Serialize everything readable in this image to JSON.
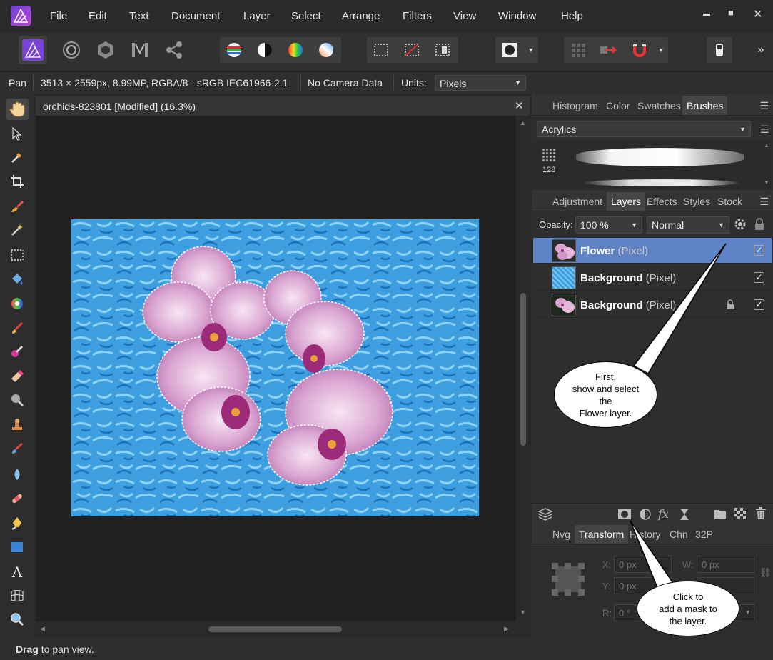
{
  "menu": {
    "items": [
      "File",
      "Edit",
      "Text",
      "Document",
      "Layer",
      "Select",
      "Arrange",
      "Filters",
      "View",
      "Window",
      "Help"
    ],
    "minimize": "▬",
    "maximize": "■",
    "close": "✕"
  },
  "toolbar": {
    "overflow": "»",
    "icons": [
      "photo-persona-icon",
      "liquify-persona-icon",
      "develop-persona-icon",
      "tone-mapping-persona-icon",
      "export-persona-icon",
      "auto-levels-icon",
      "auto-contrast-icon",
      "auto-colors-icon",
      "auto-white-balance-icon",
      "marquee-icon",
      "deselect-icon",
      "invert-selection-icon",
      "quick-mask-icon",
      "assistant-icon",
      "snapping-grid-icon",
      "force-pixel-alignment-icon",
      "snapping-magnet-icon",
      "inpaint-eraser-icon"
    ]
  },
  "context": {
    "tool_name": "Pan",
    "doc_info": "3513 × 2559px, 8.99MP, RGBA/8 - sRGB IEC61966-2.1",
    "camera": "No Camera Data",
    "units_label": "Units:",
    "units_value": "Pixels"
  },
  "document": {
    "tab_title": "orchids-823801 [Modified] (16.3%)",
    "close": "✕"
  },
  "status": {
    "bold": "Drag",
    "text": " to pan view."
  },
  "top_panel": {
    "tabs": [
      "Histogram",
      "Color",
      "Swatches",
      "Brushes"
    ],
    "active_tab": "Brushes",
    "category": "Acrylics",
    "brush_size": "128"
  },
  "layers_panel": {
    "tabs": [
      "Adjustment",
      "Layers",
      "Effects",
      "Styles",
      "Stock"
    ],
    "active_tab": "Layers",
    "opacity_label": "Opacity:",
    "opacity_value": "100 %",
    "blend_mode": "Normal",
    "layers": [
      {
        "name": "Flower",
        "type": "(Pixel)",
        "selected": true,
        "locked": false,
        "visible": true
      },
      {
        "name": "Background",
        "type": "(Pixel)",
        "selected": false,
        "locked": false,
        "visible": true
      },
      {
        "name": "Background",
        "type": "(Pixel)",
        "selected": false,
        "locked": true,
        "visible": true
      }
    ],
    "check": "✓"
  },
  "bottom_panel": {
    "tabs": [
      "Nvg",
      "Transform",
      "History",
      "Chn",
      "32P"
    ],
    "active_tab": "Transform",
    "x_label": "X:",
    "x_value": "0 px",
    "y_label": "Y:",
    "y_value": "0 px",
    "w_label": "W:",
    "w_value": "0 px",
    "r_label": "R:",
    "r_value": "0 °"
  },
  "callouts": {
    "first": [
      "First,",
      "show and select",
      "the",
      "Flower layer."
    ],
    "second": [
      "Click to",
      "add a mask to",
      "the layer."
    ]
  },
  "colors": {
    "selected_layer": "#5d82c6",
    "canvas_bg": "#212121",
    "accent_purple": "#8a3fd8"
  }
}
